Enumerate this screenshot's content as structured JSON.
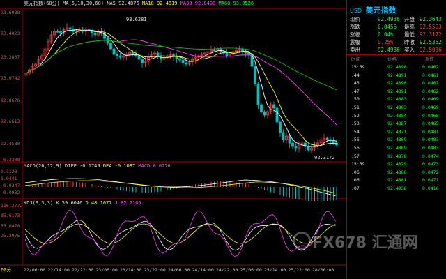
{
  "main_panel": {
    "title": "美元指数",
    "period": "(60分)",
    "ma_label": "MA(5,10,30,60)",
    "ma5": "MA5 92.4876",
    "ma10": "MA10 92.4819",
    "ma30": "MA30 92.8400",
    "ma60": "MA60 93.0526",
    "y_ticks": [
      "93.6938",
      "93.4823",
      "93.3807",
      "93.0742",
      "92.8676",
      "92.6613",
      "92.4580"
    ],
    "high_marker": "93.6281",
    "low_marker": "92.3172"
  },
  "macd_panel": {
    "label": "MACD(26,12,9)",
    "diff": "DIFF -0.1749",
    "dea": "DEA -0.1087",
    "macd": "MACD 0.0276",
    "y_ticks": [
      "0.1128",
      "0.0441",
      "-0.0247",
      "-0.0932",
      "-0.2308"
    ]
  },
  "kdj_panel": {
    "label": "KDJ(9,3,3)",
    "k": "K 59.6046",
    "d": "D 48.1677",
    "j": "J 82.7105",
    "y_ticks": [
      "116.3772",
      "85.6173",
      "55.0478",
      "25.2975"
    ]
  },
  "x_axis": {
    "period_badge": "60分",
    "ticks": [
      "22/06:00",
      "22/14:00",
      "22/22:00",
      "23/06:00",
      "23/14:00",
      "23/22:00",
      "24/06:00",
      "24/14:00",
      "24/22:00",
      "25/06:00",
      "25/14:00",
      "25/22:00",
      "28/06:00"
    ]
  },
  "side_panel": {
    "code": "USD",
    "name": "美元指数",
    "quotes": [
      {
        "l1": "现价",
        "v1": "92.4936",
        "l2": "开盘",
        "v2": "92.3643"
      },
      {
        "l1": "涨跌",
        "v1": "0.0456",
        "l2": "最高",
        "v2": "92.5593"
      },
      {
        "l1": "涨幅",
        "v1": "0.04%",
        "l2": "最低",
        "v2": "92.3172"
      },
      {
        "l1": "震幅",
        "v1": "0.25%",
        "l2": "昨收",
        "v2": "92.5352"
      },
      {
        "l1": "卖出",
        "v1": "92.4936",
        "l2": "买入",
        "v2": "92.5036"
      }
    ],
    "tick_header": {
      "time": "时间",
      "price": "价格",
      "change": "涨跌"
    },
    "ticks": [
      {
        "time": "15:59",
        "price": "92.4890",
        "change": "0.0462"
      },
      {
        "time": ".44",
        "price": "92.4891",
        "change": "0.0461"
      },
      {
        "time": ".45",
        "price": "92.4890",
        "change": "0.0461"
      },
      {
        "time": ".47",
        "price": "92.4891",
        "change": "0.0462"
      },
      {
        "time": ".50",
        "price": "92.4883",
        "change": "0.0469"
      },
      {
        "time": ".51",
        "price": "92.4883",
        "change": "0.0469"
      },
      {
        "time": ".52",
        "price": "92.4884",
        "change": "0.0468"
      },
      {
        "time": ".53",
        "price": "92.4887",
        "change": "0.0465"
      },
      {
        "time": ".54",
        "price": "92.4871",
        "change": "0.0481"
      },
      {
        "time": ".55",
        "price": "92.4869",
        "change": "0.0483"
      },
      {
        "time": ".56",
        "price": "92.4869",
        "change": "0.0483"
      },
      {
        "time": ".57",
        "price": "92.4878",
        "change": "0.0474"
      },
      {
        "time": "15:59",
        "price": "92.4879",
        "change": "0.0473"
      },
      {
        "time": ".06",
        "price": "92.4880",
        "change": "0.0472"
      },
      {
        "time": ".06",
        "price": "92.4881",
        "change": "0.0471"
      },
      {
        "time": ".07",
        "price": "92.4936",
        "change": "0.0416"
      }
    ]
  },
  "watermark": "FX678 汇通网",
  "colors": {
    "up": "#ff4040",
    "down": "#00c0c0",
    "ma5": "#ffffff",
    "ma10": "#ffff00",
    "ma30": "#ff40ff",
    "ma60": "#00c000"
  }
}
